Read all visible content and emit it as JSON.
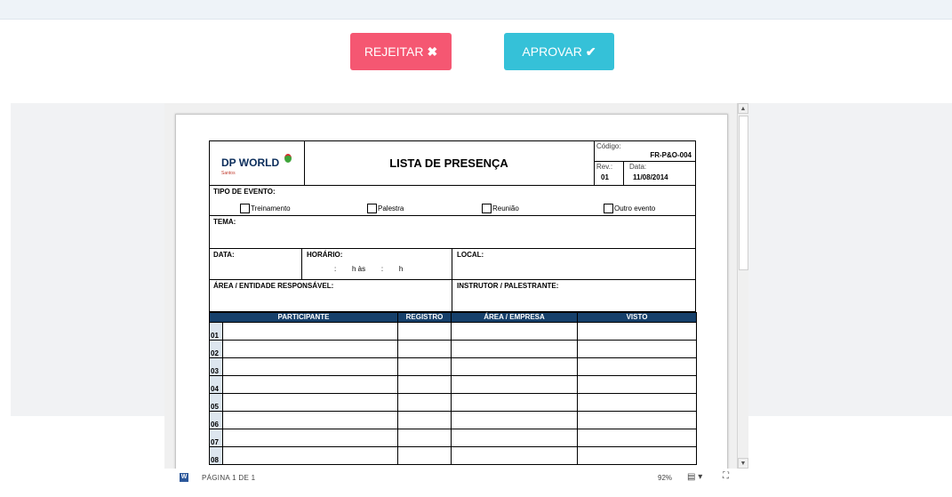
{
  "buttons": {
    "reject_label": "REJEITAR",
    "reject_icon": "✖",
    "approve_label": "APROVAR",
    "approve_icon": "✔"
  },
  "colors": {
    "reject": "#f55772",
    "approve": "#35c1d8",
    "table_header": "#16406b"
  },
  "document": {
    "logo_name": "DP WORLD",
    "logo_sub": "Santos",
    "title": "LISTA DE PRESENÇA",
    "code_label": "Código:",
    "code_value": "FR-P&O-004",
    "rev_label": "Rev.:",
    "rev_value": "01",
    "date_label": "Data:",
    "date_value": "11/08/2014",
    "event_type_label": "TIPO DE EVENTO:",
    "event_options": [
      "Treinamento",
      "Palestra",
      "Reunião",
      "Outro evento"
    ],
    "tema_label": "TEMA:",
    "data_label": "DATA:",
    "horario_label": "HORÁRIO:",
    "horario_value": ":        h às        :        h",
    "local_label": "LOCAL:",
    "area_label": "ÁREA / ENTIDADE  RESPONSÁVEL:",
    "instrutor_label": "INSTRUTOR  / PALESTRANTE:",
    "table_headers": [
      "PARTICIPANTE",
      "REGISTRO",
      "ÁREA / EMPRESA",
      "VISTO"
    ],
    "row_numbers": [
      "01",
      "02",
      "03",
      "04",
      "05",
      "06",
      "07",
      "08"
    ]
  },
  "statusbar": {
    "page": "PÁGINA 1 DE 1",
    "zoom": "92%",
    "word_icon": "W"
  }
}
